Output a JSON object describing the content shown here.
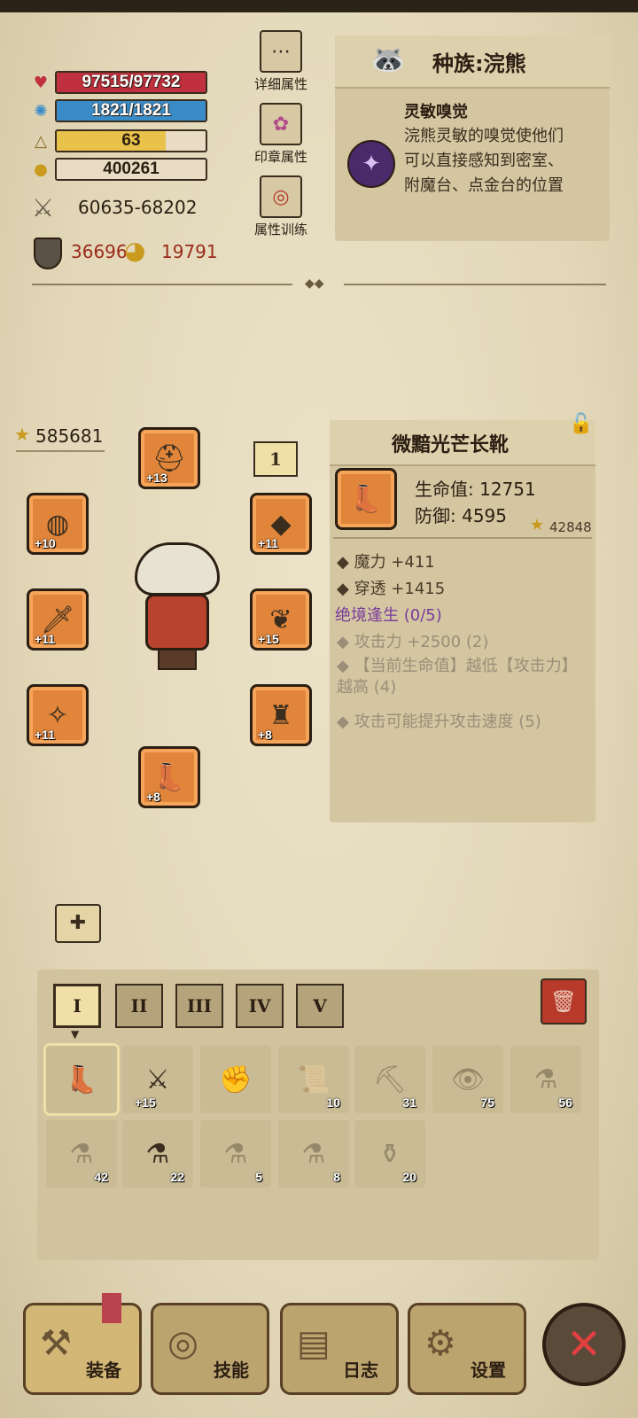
{
  "stats": {
    "hp": {
      "text": "97515/97732",
      "icon": "heart-icon",
      "color": "#c0303e",
      "fraction": 0.998
    },
    "mp": {
      "text": "1821/1821",
      "icon": "gear-icon",
      "color": "#3a8cc8",
      "fraction": 1.0
    },
    "level": {
      "text": "63",
      "icon": "level-triangle-icon",
      "color": "#e8c24a",
      "fraction": 0.73
    },
    "gold": {
      "text": "400261",
      "icon": "gold-coins-icon"
    },
    "attack": {
      "text": "60635-68202",
      "icon": "crossed-swords-icon"
    },
    "defense": {
      "text": "36696",
      "icon": "shield-icon"
    },
    "magic_def": {
      "text": "19791",
      "icon": "orb-icon"
    }
  },
  "side_buttons": [
    {
      "label": "详细属性",
      "icon": "dots-icon"
    },
    {
      "label": "印章属性",
      "icon": "flower-seal-icon"
    },
    {
      "label": "属性训练",
      "icon": "target-icon"
    }
  ],
  "race": {
    "title": "种族:浣熊",
    "skill_name": "灵敏嗅觉",
    "skill_desc": "浣熊灵敏的嗅觉使他们可以直接感知到密室、附魔台、点金台的位置"
  },
  "equipment": {
    "score": "585681",
    "level_badge": "1",
    "slots": [
      {
        "name": "helmet",
        "plus": "+13"
      },
      {
        "name": "bracelet",
        "plus": "+10"
      },
      {
        "name": "weapon",
        "plus": "+11"
      },
      {
        "name": "amulet",
        "plus": "+11"
      },
      {
        "name": "boots",
        "plus": "+8"
      },
      {
        "name": "necklace",
        "plus": "+11"
      },
      {
        "name": "wings",
        "plus": "+15"
      },
      {
        "name": "armor",
        "plus": "+8"
      }
    ]
  },
  "item": {
    "title": "微黯光芒长靴",
    "hp": "生命值: 12751",
    "def": "防御: 4595",
    "score": "42848",
    "attrs": [
      "魔力 +411",
      "穿透 +1415"
    ],
    "set_name": "绝境逢生 (0/5)",
    "set_bonus": [
      "攻击力 +2500 (2)",
      "【当前生命值】越低【攻击力】越高 (4)",
      "攻击可能提升攻击速度 (5)"
    ]
  },
  "tabs": [
    "I",
    "II",
    "III",
    "IV",
    "V"
  ],
  "inventory": [
    {
      "icon": "boots-icon",
      "count": ""
    },
    {
      "icon": "armor-spiked-icon",
      "count": "+15"
    },
    {
      "icon": "gauntlet-icon",
      "count": ""
    },
    {
      "icon": "scroll-icon",
      "count": "10"
    },
    {
      "icon": "pickaxe-icon",
      "count": "31"
    },
    {
      "icon": "eye-crystal-icon",
      "count": "75"
    },
    {
      "icon": "red-potion-icon",
      "count": "56"
    },
    {
      "icon": "teal-potion-icon",
      "count": "42"
    },
    {
      "icon": "pink-potion-icon",
      "count": "22"
    },
    {
      "icon": "orange-potion-icon",
      "count": "5"
    },
    {
      "icon": "blue-potion-icon",
      "count": "8"
    },
    {
      "icon": "jar-icon",
      "count": "20"
    }
  ],
  "nav": [
    "装备",
    "技能",
    "日志",
    "设置"
  ]
}
